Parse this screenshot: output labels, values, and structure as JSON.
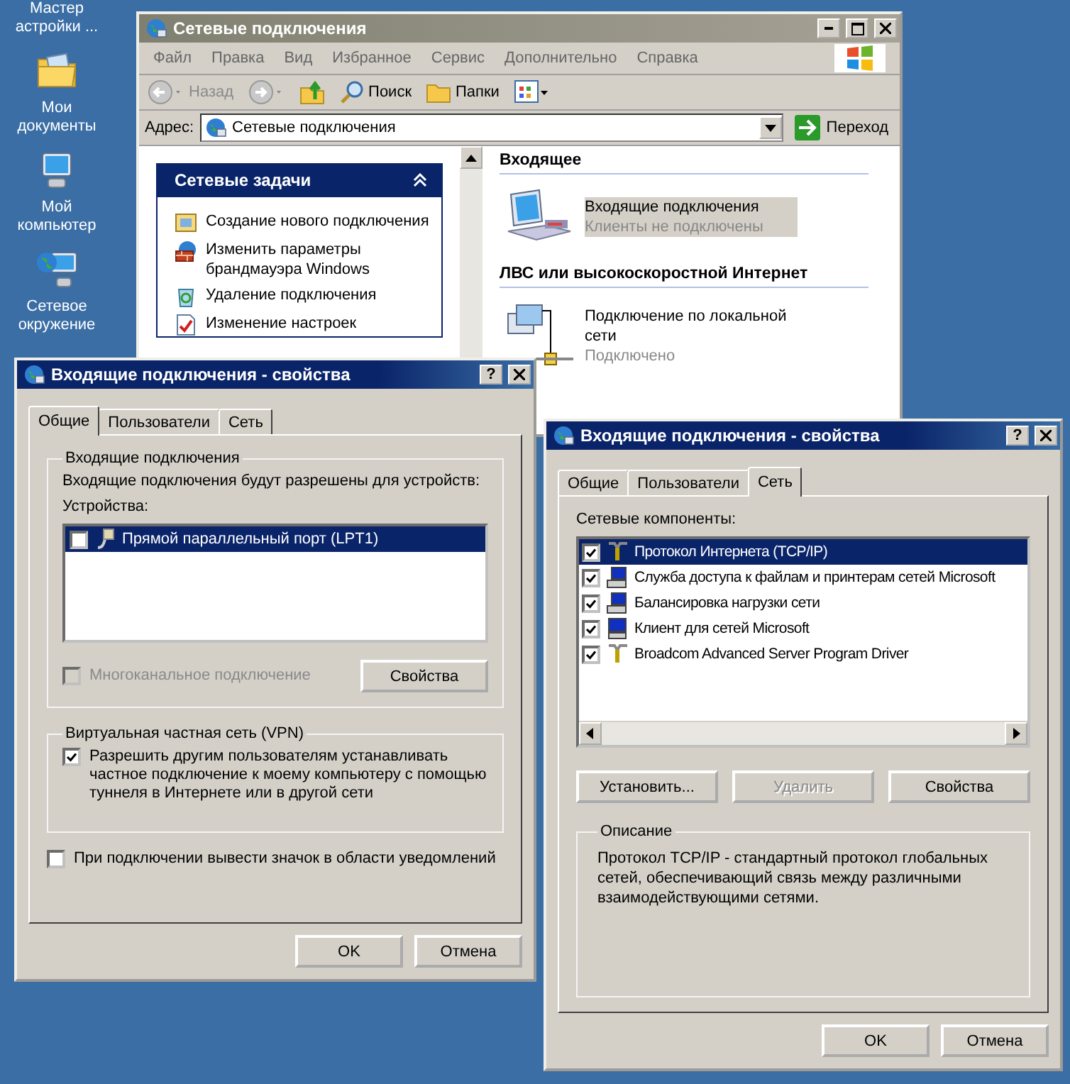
{
  "desktop_icons": [
    {
      "label": "Мастер\nастройки ...",
      "kind": "none"
    },
    {
      "label": "Мои\nдокументы",
      "kind": "folder"
    },
    {
      "label": "Мой\nкомпьютер",
      "kind": "computer"
    },
    {
      "label": "Сетевое\nокружение",
      "kind": "network"
    }
  ],
  "explorer": {
    "title": "Сетевые подключения",
    "menu": [
      "Файл",
      "Правка",
      "Вид",
      "Избранное",
      "Сервис",
      "Дополнительно",
      "Справка"
    ],
    "toolbar": [
      {
        "label": "Назад",
        "kind": "back",
        "disabled": true
      },
      {
        "kind": "forward",
        "disabled": true
      },
      {
        "kind": "up"
      },
      {
        "label": "Поиск",
        "kind": "search"
      },
      {
        "label": "Папки",
        "kind": "folders"
      },
      {
        "kind": "views"
      }
    ],
    "address": {
      "label": "Адрес:",
      "value": "Сетевые подключения",
      "go": "Переход"
    },
    "tasks": {
      "title": "Сетевые задачи",
      "items": [
        {
          "label": "Создание нового подключения",
          "kind": "new"
        },
        {
          "label": "Изменить параметры брандмауэра Windows",
          "kind": "firewall"
        },
        {
          "label": "Удаление подключения",
          "kind": "delete"
        },
        {
          "label": "Изменение настроек",
          "kind": "edit"
        }
      ]
    },
    "groups": [
      {
        "heading": "Входящее",
        "items": [
          {
            "name": "Входящие подключения",
            "status": "Клиенты не подключены",
            "kind": "incoming",
            "selected": true
          }
        ]
      },
      {
        "heading": "ЛВС или высокоскоростной Интернет",
        "items": [
          {
            "name": "Подключение по локальной сети",
            "status": "Подключено",
            "kind": "lan",
            "selected": false
          }
        ]
      }
    ]
  },
  "dialogs": [
    {
      "kind": "general",
      "title": "Входящие подключения - свойства",
      "help": "?",
      "tabs": [
        {
          "label": "Общие",
          "selected": true
        },
        {
          "label": "Пользователи",
          "selected": false
        },
        {
          "label": "Сеть",
          "selected": false
        }
      ],
      "devices_group": {
        "title": "Входящие подключения",
        "text": "Входящие подключения будут разрешены для устройств:",
        "list_label": "Устройства:",
        "devices": [
          {
            "label": "Прямой параллельный порт (LPT1)",
            "checked": false,
            "selected": true
          }
        ],
        "multilink": {
          "label": "Многоканальное подключение",
          "checked": false,
          "disabled": true
        },
        "button": "Свойства"
      },
      "vpn_group": {
        "title": "Виртуальная частная сеть (VPN)",
        "option": {
          "label": "Разрешить другим пользователям устанавливать частное подключение к моему компьютеру с помощью туннеля в Интернете или в другой сети",
          "checked": true
        }
      },
      "notify": {
        "label": "При подключении вывести значок в области уведомлений",
        "checked": false
      },
      "buttons": [
        "OK",
        "Отмена"
      ]
    },
    {
      "kind": "network",
      "title": "Входящие подключения - свойства",
      "help": "?",
      "tabs": [
        {
          "label": "Общие",
          "selected": false
        },
        {
          "label": "Пользователи",
          "selected": false
        },
        {
          "label": "Сеть",
          "selected": true
        }
      ],
      "list_label": "Сетевые компоненты:",
      "components": [
        {
          "label": "Протокол Интернета (TCP/IP)",
          "kind": "protocol",
          "checked": true,
          "selected": true
        },
        {
          "label": "Служба доступа к файлам и принтерам сетей Microsoft",
          "kind": "service",
          "checked": true,
          "selected": false
        },
        {
          "label": "Балансировка нагрузки сети",
          "kind": "service",
          "checked": true,
          "selected": false
        },
        {
          "label": "Клиент для сетей Microsoft",
          "kind": "client",
          "checked": true,
          "selected": false
        },
        {
          "label": "Broadcom Advanced Server Program Driver",
          "kind": "protocol",
          "checked": true,
          "selected": false
        }
      ],
      "actions": [
        {
          "label": "Установить...",
          "disabled": false
        },
        {
          "label": "Удалить",
          "disabled": true
        },
        {
          "label": "Свойства",
          "disabled": false
        }
      ],
      "description": {
        "title": "Описание",
        "text": "Протокол TCP/IP - стандартный протокол глобальных сетей, обеспечивающий связь между различными взаимодействующими сетями."
      },
      "buttons": [
        "OK",
        "Отмена"
      ]
    }
  ]
}
